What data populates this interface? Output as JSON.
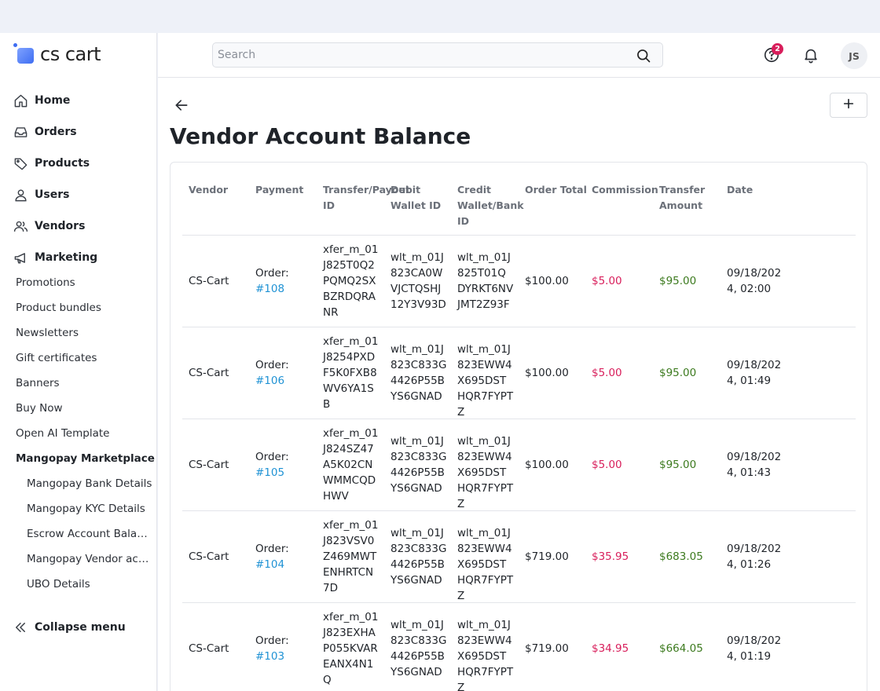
{
  "app": {
    "logo_text": "cs cart"
  },
  "sidebar": {
    "main_items": [
      {
        "label": "Home",
        "icon": "home-icon"
      },
      {
        "label": "Orders",
        "icon": "inbox-icon"
      },
      {
        "label": "Products",
        "icon": "tag-icon"
      },
      {
        "label": "Users",
        "icon": "user-icon"
      },
      {
        "label": "Vendors",
        "icon": "users-icon"
      },
      {
        "label": "Marketing",
        "icon": "megaphone-icon"
      }
    ],
    "marketing_items": [
      "Promotions",
      "Product bundles",
      "Newsletters",
      "Gift certificates",
      "Banners",
      "Buy Now",
      "Open AI Template",
      "Mangopay Marketplace"
    ],
    "mangopay_items": [
      "Mangopay Bank Details",
      "Mangopay KYC Details",
      "Escrow Account Balance",
      "Mangopay Vendor account balance",
      "UBO Details"
    ],
    "collapse_label": "Collapse menu"
  },
  "topbar": {
    "search_placeholder": "Search",
    "help_badge": "2",
    "avatar_initials": "JS"
  },
  "page": {
    "title": "Vendor Account Balance"
  },
  "table": {
    "headers": [
      "Vendor",
      "Payment",
      "Transfer/Payout ID",
      "Debit Wallet ID",
      "Credit Wallet/Bank ID",
      "Order Total",
      "Commission",
      "Transfer Amount",
      "Date"
    ],
    "rows": [
      {
        "vendor": "CS-Cart",
        "payment_prefix": "Order:",
        "payment_link": "#108",
        "transfer_id": "xfer_m_01J825T0Q2PQMQ2SXBZRDQRANR",
        "debit_wallet": "wlt_m_01J823CA0WVJCTQSHJ12Y3V93D",
        "credit_wallet": "wlt_m_01J825T01QDYRKT6NVJMT2Z93F",
        "order_total": "$100.00",
        "commission": "$5.00",
        "transfer_amount": "$95.00",
        "date": "09/18/2024, 02:00"
      },
      {
        "vendor": "CS-Cart",
        "payment_prefix": "Order:",
        "payment_link": "#106",
        "transfer_id": "xfer_m_01J8254PXDF5K0FXB8WV6YA1SB",
        "debit_wallet": "wlt_m_01J823C833G4426P55BYS6GNAD",
        "credit_wallet": "wlt_m_01J823EWW4X695DSTHQR7FYPTZ",
        "order_total": "$100.00",
        "commission": "$5.00",
        "transfer_amount": "$95.00",
        "date": "09/18/2024, 01:49"
      },
      {
        "vendor": "CS-Cart",
        "payment_prefix": "Order:",
        "payment_link": "#105",
        "transfer_id": "xfer_m_01J824SZ47A5K02CNWMMCQDHWV",
        "debit_wallet": "wlt_m_01J823C833G4426P55BYS6GNAD",
        "credit_wallet": "wlt_m_01J823EWW4X695DSTHQR7FYPTZ",
        "order_total": "$100.00",
        "commission": "$5.00",
        "transfer_amount": "$95.00",
        "date": "09/18/2024, 01:43"
      },
      {
        "vendor": "CS-Cart",
        "payment_prefix": "Order:",
        "payment_link": "#104",
        "transfer_id": "xfer_m_01J823VSV0Z469MWTENHRTCN7D",
        "debit_wallet": "wlt_m_01J823C833G4426P55BYS6GNAD",
        "credit_wallet": "wlt_m_01J823EWW4X695DSTHQR7FYPTZ",
        "order_total": "$719.00",
        "commission": "$35.95",
        "transfer_amount": "$683.05",
        "date": "09/18/2024, 01:26"
      },
      {
        "vendor": "CS-Cart",
        "payment_prefix": "Order:",
        "payment_link": "#103",
        "transfer_id": "xfer_m_01J823EXHAP055KVAREANX4N1Q",
        "debit_wallet": "wlt_m_01J823C833G4426P55BYS6GNAD",
        "credit_wallet": "wlt_m_01J823EWW4X695DSTHQR7FYPTZ",
        "order_total": "$719.00",
        "commission": "$34.95",
        "transfer_amount": "$664.05",
        "date": "09/18/2024, 01:19"
      }
    ]
  },
  "colors": {
    "accent": "#1f92d4",
    "commission": "#d81e5b",
    "transfer": "#3c7a1e",
    "badge": "#d81e5b"
  }
}
